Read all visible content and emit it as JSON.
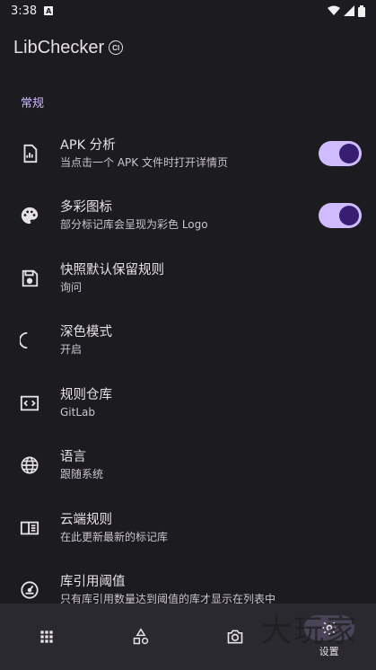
{
  "status_bar": {
    "time": "3:38",
    "notification_letter": "A"
  },
  "app_bar": {
    "title": "LibChecker",
    "badge": "CI"
  },
  "section": {
    "title": "常规"
  },
  "prefs": [
    {
      "title": "APK 分析",
      "summary": "当点击一个 APK 文件时打开详情页",
      "icon": "apk-analysis-icon",
      "switch": true
    },
    {
      "title": "多彩图标",
      "summary": "部分标记库会呈现为彩色 Logo",
      "icon": "palette-icon",
      "switch": true
    },
    {
      "title": "快照默认保留规则",
      "summary": "询问",
      "icon": "save-icon",
      "switch": false
    },
    {
      "title": "深色模式",
      "summary": "开启",
      "icon": "moon-icon",
      "switch": false
    },
    {
      "title": "规则仓库",
      "summary": "GitLab",
      "icon": "code-icon",
      "switch": false
    },
    {
      "title": "语言",
      "summary": "跟随系统",
      "icon": "globe-icon",
      "switch": false
    },
    {
      "title": "云端规则",
      "summary": "在此更新最新的标记库",
      "icon": "book-icon",
      "switch": false
    },
    {
      "title": "库引用阈值",
      "summary": "只有库引用数量达到阈值的库才显示在列表中",
      "icon": "gauge-icon",
      "switch": false
    }
  ],
  "bottom_nav": {
    "items": [
      {
        "icon": "apps-icon",
        "label": ""
      },
      {
        "icon": "shapes-icon",
        "label": ""
      },
      {
        "icon": "camera-icon",
        "label": ""
      },
      {
        "icon": "settings-icon",
        "label": "设置",
        "active": true
      }
    ]
  },
  "watermark": "大玩家",
  "colors": {
    "background": "#1c1b1f",
    "accent": "#cfbcff",
    "switch_thumb": "#381e72",
    "nav_bg": "#2b2930"
  }
}
